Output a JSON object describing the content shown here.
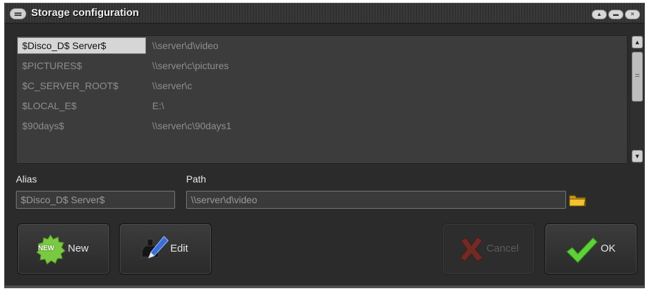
{
  "window": {
    "title": "Storage configuration"
  },
  "list": {
    "rows": [
      {
        "alias": "$Disco_D$ Server$",
        "path": "\\\\server\\d\\video"
      },
      {
        "alias": "$PICTURES$",
        "path": "\\\\server\\c\\pictures"
      },
      {
        "alias": "$C_SERVER_ROOT$",
        "path": "\\\\server\\c"
      },
      {
        "alias": "$LOCAL_E$",
        "path": "E:\\"
      },
      {
        "alias": "$90days$",
        "path": "\\\\server\\c\\90days1"
      }
    ],
    "selected_index": 0
  },
  "form": {
    "alias_label": "Alias",
    "alias_value": "$Disco_D$ Server$",
    "path_label": "Path",
    "path_value": "\\\\server\\d\\video"
  },
  "buttons": {
    "new_label": "New",
    "new_badge": "NEW",
    "edit_label": "Edit",
    "cancel_label": "Cancel",
    "ok_label": "OK"
  },
  "colors": {
    "new_badge": "#7ac943",
    "ok_check": "#5fd03a",
    "cancel_x": "#c0392b",
    "folder": "#f2c230"
  },
  "icons": {
    "system_menu": "system-menu-icon",
    "folder": "folder-icon",
    "new": "new-badge-icon",
    "edit": "edit-pen-icon",
    "cancel": "cancel-x-icon",
    "ok": "checkmark-icon"
  }
}
